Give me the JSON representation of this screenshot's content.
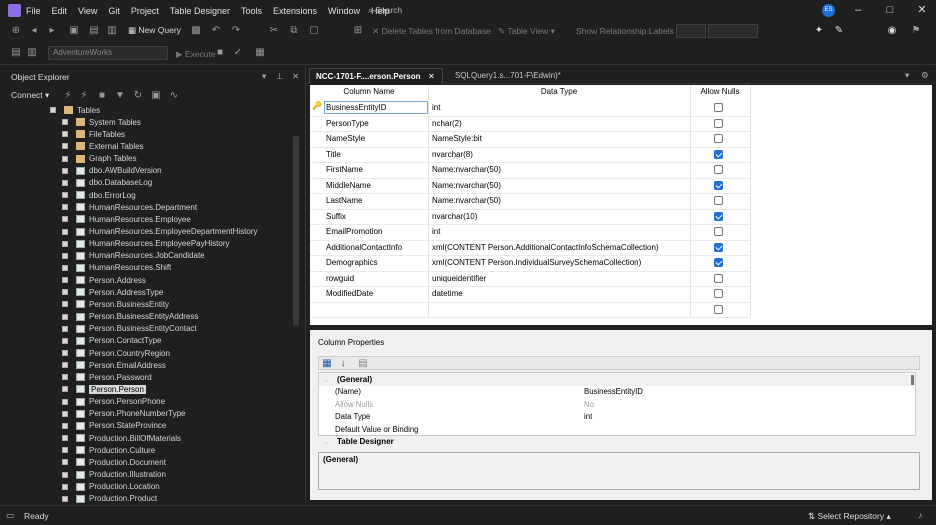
{
  "menubar": {
    "items": [
      "File",
      "Edit",
      "View",
      "Git",
      "Project",
      "Table Designer",
      "Tools",
      "Extensions",
      "Window",
      "Help"
    ],
    "search_label": "Search",
    "avatar_initials": "ES"
  },
  "toolbar": {
    "new_query": "New Query",
    "database": "AdventureWorks",
    "execute": "Execute",
    "delete_tables": "Delete Tables from Database",
    "table_view": "Table View",
    "show_relationship": "Show Relationship Labels"
  },
  "object_explorer": {
    "title": "Object Explorer",
    "connect": "Connect",
    "root": "Tables",
    "folders": [
      "System Tables",
      "FileTables",
      "External Tables",
      "Graph Tables"
    ],
    "tables": [
      "dbo.AWBuildVersion",
      "dbo.DatabaseLog",
      "dbo.ErrorLog",
      "HumanResources.Department",
      "HumanResources.Employee",
      "HumanResources.EmployeeDepartmentHistory",
      "HumanResources.EmployeePayHistory",
      "HumanResources.JobCandidate",
      "HumanResources.Shift",
      "Person.Address",
      "Person.AddressType",
      "Person.BusinessEntity",
      "Person.BusinessEntityAddress",
      "Person.BusinessEntityContact",
      "Person.ContactType",
      "Person.CountryRegion",
      "Person.EmailAddress",
      "Person.Password",
      "Person.Person",
      "Person.PersonPhone",
      "Person.PhoneNumberType",
      "Person.StateProvince",
      "Production.BillOfMaterials",
      "Production.Culture",
      "Production.Document",
      "Production.Illustration",
      "Production.Location",
      "Production.Product"
    ],
    "selected_table": "Person.Person"
  },
  "tabs": [
    {
      "label": "NCC-1701-F....erson.Person",
      "active": true
    },
    {
      "label": "SQLQuery1.s...701-F\\Edwin)*",
      "active": false
    }
  ],
  "grid": {
    "headers": [
      "Column Name",
      "Data Type",
      "Allow Nulls"
    ],
    "rows": [
      {
        "name": "BusinessEntityID",
        "type": "int",
        "nulls": false
      },
      {
        "name": "PersonType",
        "type": "nchar(2)",
        "nulls": false
      },
      {
        "name": "NameStyle",
        "type": "NameStyle:bit",
        "nulls": false
      },
      {
        "name": "Title",
        "type": "nvarchar(8)",
        "nulls": true
      },
      {
        "name": "FirstName",
        "type": "Name:nvarchar(50)",
        "nulls": false
      },
      {
        "name": "MiddleName",
        "type": "Name:nvarchar(50)",
        "nulls": true
      },
      {
        "name": "LastName",
        "type": "Name:nvarchar(50)",
        "nulls": false
      },
      {
        "name": "Suffix",
        "type": "nvarchar(10)",
        "nulls": true
      },
      {
        "name": "EmailPromotion",
        "type": "int",
        "nulls": false
      },
      {
        "name": "AdditionalContactInfo",
        "type": "xml(CONTENT Person.AdditionalContactInfoSchemaCollection)",
        "nulls": true
      },
      {
        "name": "Demographics",
        "type": "xml(CONTENT Person.IndividualSurveySchemaCollection)",
        "nulls": true
      },
      {
        "name": "rowguid",
        "type": "uniqueidentifier",
        "nulls": false
      },
      {
        "name": "ModifiedDate",
        "type": "datetime",
        "nulls": false
      },
      {
        "name": "",
        "type": "",
        "nulls": false
      }
    ]
  },
  "column_properties": {
    "title": "Column Properties",
    "general": "(General)",
    "props": [
      {
        "k": "(Name)",
        "v": "BusinessEntityID"
      },
      {
        "k": "Allow Nulls",
        "v": "No"
      },
      {
        "k": "Data Type",
        "v": "int"
      },
      {
        "k": "Default Value or Binding",
        "v": ""
      }
    ],
    "table_designer": "Table Designer",
    "desc_title": "(General)"
  },
  "status": {
    "ready": "Ready",
    "repo": "Select Repository"
  }
}
